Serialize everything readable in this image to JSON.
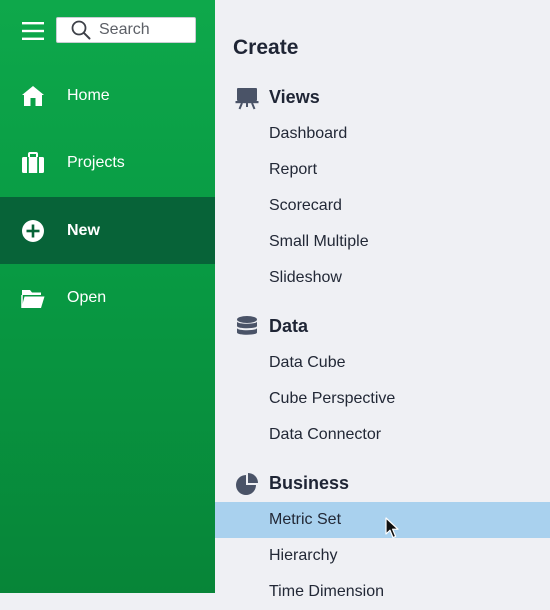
{
  "sidebar": {
    "search": {
      "placeholder": "Search"
    },
    "nav": [
      {
        "label": "Home",
        "icon": "home-icon"
      },
      {
        "label": "Projects",
        "icon": "briefcase-icon"
      },
      {
        "label": "New",
        "icon": "plus-circle-icon",
        "active": true
      },
      {
        "label": "Open",
        "icon": "folder-open-icon"
      }
    ],
    "colors": {
      "gradient_top": "#0ea84b",
      "gradient_bottom": "#078538",
      "active": "#076338"
    }
  },
  "main": {
    "title": "Create",
    "sections": [
      {
        "label": "Views",
        "icon": "presentation-easel-icon",
        "items": [
          "Dashboard",
          "Report",
          "Scorecard",
          "Small Multiple",
          "Slideshow"
        ]
      },
      {
        "label": "Data",
        "icon": "database-icon",
        "items": [
          "Data Cube",
          "Cube Perspective",
          "Data Connector"
        ]
      },
      {
        "label": "Business",
        "icon": "pie-chart-icon",
        "items": [
          "Metric Set",
          "Hierarchy",
          "Time Dimension"
        ],
        "selected": "Metric Set"
      }
    ],
    "colors": {
      "background": "#eff0f4",
      "selected": "#a9d1ee",
      "text": "#1f2535"
    }
  }
}
